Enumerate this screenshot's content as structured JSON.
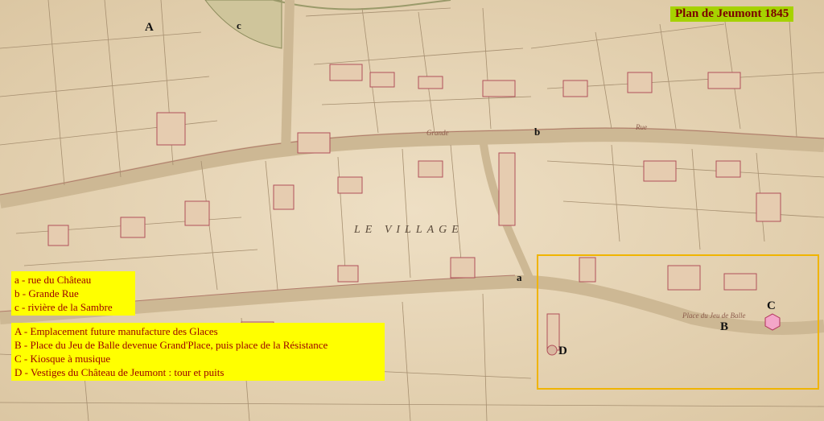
{
  "title": "Plan de Jeumont 1845",
  "legend_streets": [
    "a - rue du Château",
    "b - Grande Rue",
    "c - rivière de la Sambre"
  ],
  "legend_places": [
    "A - Emplacement future manufacture des Glaces",
    "B - Place du Jeu de Balle devenue Grand'Place, puis place de la Résistance",
    "C - Kiosque à musique",
    "D - Vestiges du Château de Jeumont : tour et puits"
  ],
  "map_labels": {
    "A": "A",
    "B": "B",
    "C": "C",
    "D": "D",
    "a": "a",
    "b": "b",
    "c": "c",
    "village": "LE VILLAGE",
    "grande_rue": "Grande",
    "rue": "Rue",
    "place": "Place du Jeu de Balle"
  },
  "colors": {
    "parchment": "#e9d9bd",
    "title_bg": "#a6d200",
    "legend_bg": "#ffff00",
    "legend_text": "#9b0000",
    "highlight": "#f0b400",
    "kiosk": "#f4a6c8"
  }
}
